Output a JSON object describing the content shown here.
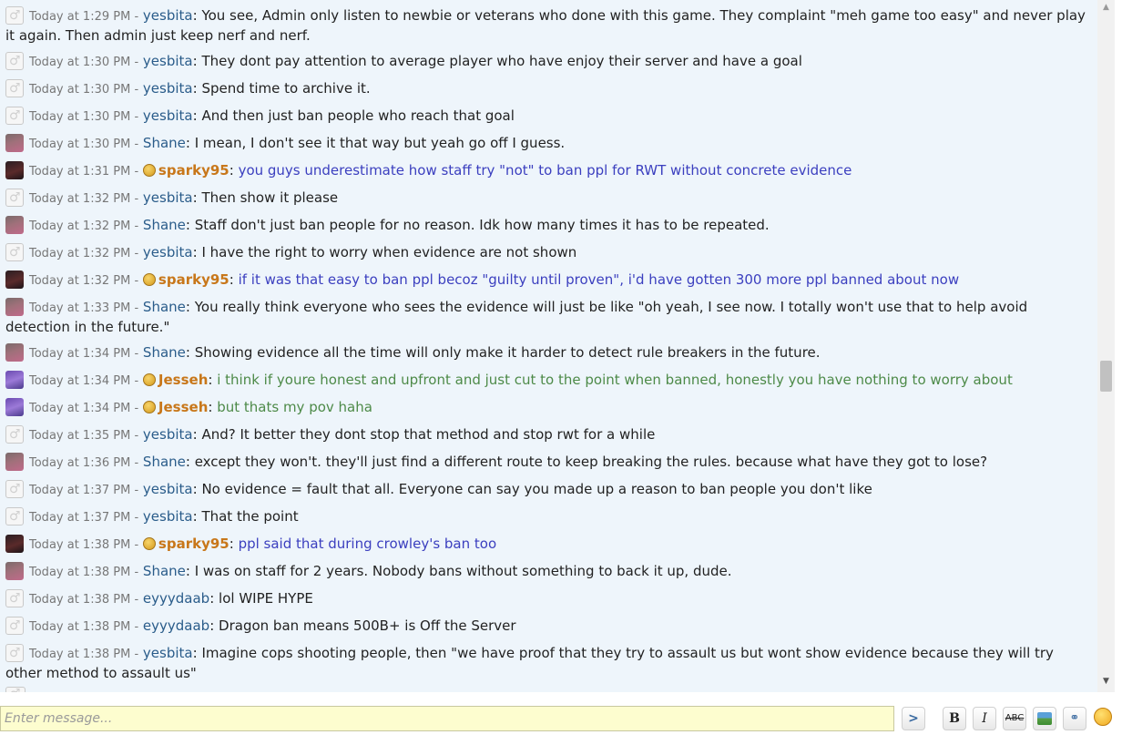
{
  "messages": [
    {
      "avatar": "default",
      "time": "Today at 1:29 PM -",
      "user": "yesbita",
      "badge": false,
      "staff": false,
      "text": "You see, Admin only listen to newbie or veterans who done with this game. They complaint \"meh game too easy\" and never play it again. Then admin just keep nerf and nerf.",
      "style": "normal"
    },
    {
      "avatar": "default",
      "time": "Today at 1:30 PM -",
      "user": "yesbita",
      "badge": false,
      "staff": false,
      "text": "They dont pay attention to average player who have enjoy their server and have a goal",
      "style": "normal"
    },
    {
      "avatar": "default",
      "time": "Today at 1:30 PM -",
      "user": "yesbita",
      "badge": false,
      "staff": false,
      "text": "Spend time to archive it.",
      "style": "normal"
    },
    {
      "avatar": "default",
      "time": "Today at 1:30 PM -",
      "user": "yesbita",
      "badge": false,
      "staff": false,
      "text": "And then just ban people who reach that goal",
      "style": "normal"
    },
    {
      "avatar": "shane",
      "time": "Today at 1:30 PM -",
      "user": "Shane",
      "badge": false,
      "staff": false,
      "text": "I mean, I don't see it that way but yeah go off I guess.",
      "style": "normal"
    },
    {
      "avatar": "sparky",
      "time": "Today at 1:31 PM -",
      "user": "sparky95",
      "badge": true,
      "staff": true,
      "text": "you guys underestimate how staff try \"not\" to ban ppl for RWT without concrete evidence",
      "style": "blue"
    },
    {
      "avatar": "default",
      "time": "Today at 1:32 PM -",
      "user": "yesbita",
      "badge": false,
      "staff": false,
      "text": "Then show it please",
      "style": "normal"
    },
    {
      "avatar": "shane",
      "time": "Today at 1:32 PM -",
      "user": "Shane",
      "badge": false,
      "staff": false,
      "text": "Staff don't just ban people for no reason. Idk how many times it has to be repeated.",
      "style": "normal"
    },
    {
      "avatar": "default",
      "time": "Today at 1:32 PM -",
      "user": "yesbita",
      "badge": false,
      "staff": false,
      "text": "I have the right to worry when evidence are not shown",
      "style": "normal"
    },
    {
      "avatar": "sparky",
      "time": "Today at 1:32 PM -",
      "user": "sparky95",
      "badge": true,
      "staff": true,
      "text": "if it was that easy to ban ppl becoz \"guilty until proven\", i'd have gotten 300 more ppl banned about now",
      "style": "blue"
    },
    {
      "avatar": "shane",
      "time": "Today at 1:33 PM -",
      "user": "Shane",
      "badge": false,
      "staff": false,
      "text": "You really think everyone who sees the evidence will just be like \"oh yeah, I see now. I totally won't use that to help avoid detection in the future.\"",
      "style": "normal"
    },
    {
      "avatar": "shane",
      "time": "Today at 1:34 PM -",
      "user": "Shane",
      "badge": false,
      "staff": false,
      "text": "Showing evidence all the time will only make it harder to detect rule breakers in the future.",
      "style": "normal"
    },
    {
      "avatar": "jesseh",
      "time": "Today at 1:34 PM -",
      "user": "Jesseh",
      "badge": true,
      "staff": true,
      "text": "i think if youre honest and upfront and just cut to the point when banned, honestly you have nothing to worry about",
      "style": "green"
    },
    {
      "avatar": "jesseh",
      "time": "Today at 1:34 PM -",
      "user": "Jesseh",
      "badge": true,
      "staff": true,
      "text": "but thats my pov haha",
      "style": "green"
    },
    {
      "avatar": "default",
      "time": "Today at 1:35 PM -",
      "user": "yesbita",
      "badge": false,
      "staff": false,
      "text": "And? It better they dont stop that method and stop rwt for a while",
      "style": "normal"
    },
    {
      "avatar": "shane",
      "time": "Today at 1:36 PM -",
      "user": "Shane",
      "badge": false,
      "staff": false,
      "text": "except they won't. they'll just find a different route to keep breaking the rules. because what have they got to lose?",
      "style": "normal"
    },
    {
      "avatar": "default",
      "time": "Today at 1:37 PM -",
      "user": "yesbita",
      "badge": false,
      "staff": false,
      "text": "No evidence = fault that all. Everyone can say you made up a reason to ban people you don't like",
      "style": "normal"
    },
    {
      "avatar": "default",
      "time": "Today at 1:37 PM -",
      "user": "yesbita",
      "badge": false,
      "staff": false,
      "text": "That the point",
      "style": "normal"
    },
    {
      "avatar": "sparky",
      "time": "Today at 1:38 PM -",
      "user": "sparky95",
      "badge": true,
      "staff": true,
      "text": "ppl said that during crowley's ban too",
      "style": "blue"
    },
    {
      "avatar": "shane",
      "time": "Today at 1:38 PM -",
      "user": "Shane",
      "badge": false,
      "staff": false,
      "text": "I was on staff for 2 years. Nobody bans without something to back it up, dude.",
      "style": "normal"
    },
    {
      "avatar": "default",
      "time": "Today at 1:38 PM -",
      "user": "eyyydaab",
      "badge": false,
      "staff": false,
      "text": "lol WIPE HYPE",
      "style": "normal"
    },
    {
      "avatar": "default",
      "time": "Today at 1:38 PM -",
      "user": "eyyydaab",
      "badge": false,
      "staff": false,
      "text": "Dragon ban means 500B+ is Off the Server",
      "style": "normal"
    },
    {
      "avatar": "default",
      "time": "Today at 1:38 PM -",
      "user": "yesbita",
      "badge": false,
      "staff": false,
      "text": "Imagine cops shooting people, then \"we have proof that they try to assault us but wont show evidence because they will try other method to assault us\"",
      "style": "normal"
    }
  ],
  "scroll_position": 0.55,
  "input": {
    "placeholder": "Enter message..."
  },
  "toolbar": {
    "send_label": ">",
    "bold_label": "B",
    "italic_label": "I",
    "strike_label": "ABC",
    "icons": [
      "image-icon",
      "link-icon",
      "smiley-icon"
    ]
  }
}
